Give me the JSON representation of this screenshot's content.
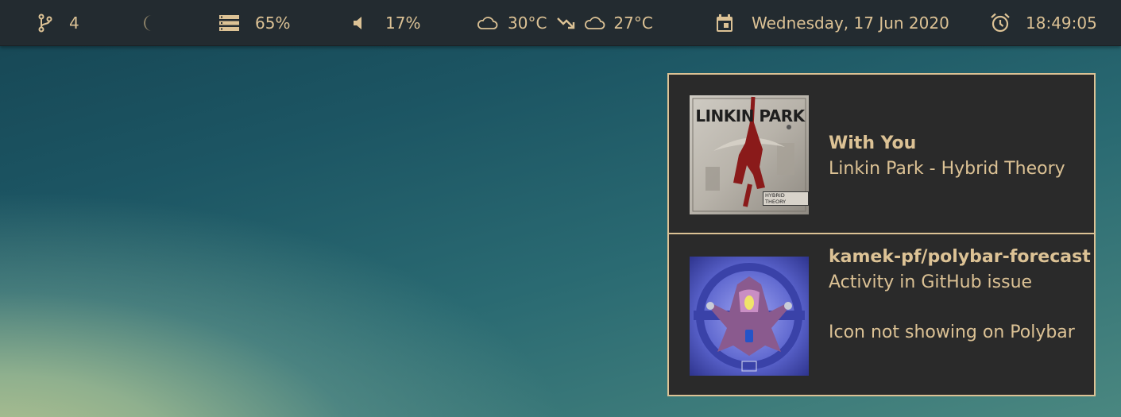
{
  "statusbar": {
    "workspaces": {
      "icon": "git-branch-icon",
      "value": "4"
    },
    "night_mode": {
      "icon": "moon-icon"
    },
    "storage": {
      "icon": "storage-icon",
      "value": "65%"
    },
    "volume": {
      "icon": "speaker-icon",
      "value": "17%"
    },
    "weather": {
      "current_icon": "cloud-icon",
      "current_temp": "30°C",
      "trend_icon": "trending-down-icon",
      "forecast_icon": "cloud-icon",
      "forecast_temp": "27°C"
    },
    "date": {
      "icon": "calendar-icon",
      "value": "Wednesday, 17 Jun 2020"
    },
    "clock": {
      "icon": "alarm-clock-icon",
      "value": "18:49:05"
    }
  },
  "notifications": [
    {
      "title": "With You",
      "body": "Linkin Park - Hybrid Theory",
      "image": "album-art",
      "art_label": "LINKIN PARK",
      "art_sub": "HYBRID THEORY"
    },
    {
      "title": "kamek-pf/polybar-forecast",
      "body": "Activity in GitHub issue",
      "detail": "Icon not showing on Polybar",
      "image": "github-avatar"
    }
  ],
  "colors": {
    "bar_bg": "#232b30",
    "accent": "#dcc295",
    "notification_bg": "#2a2a2a"
  }
}
